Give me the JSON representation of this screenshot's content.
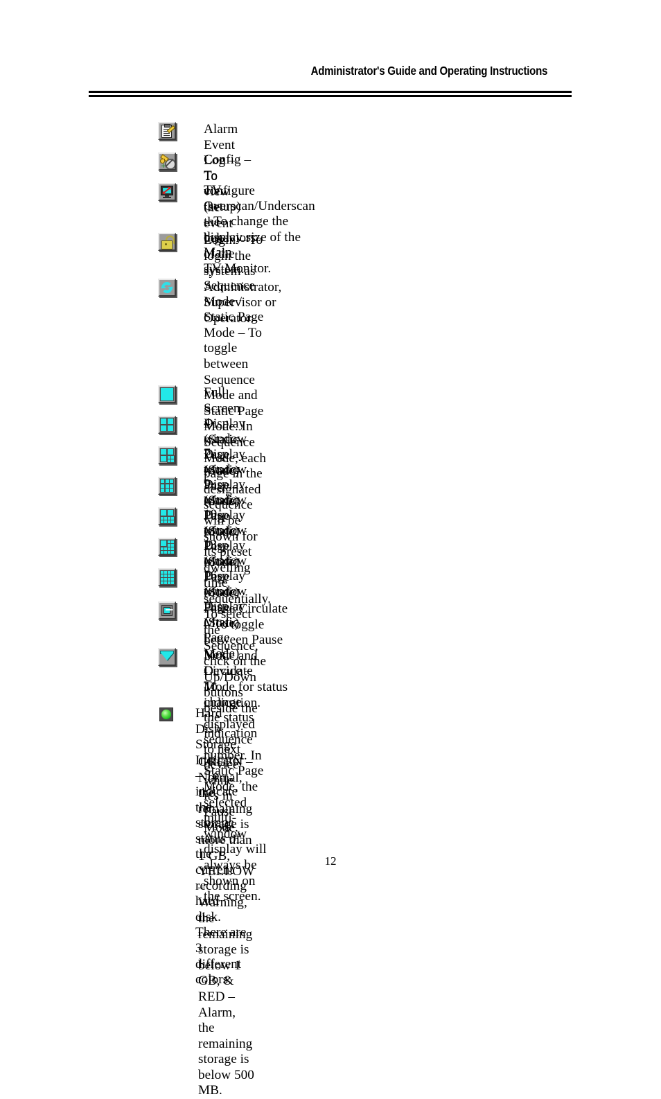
{
  "header": {
    "title": "Administrator's Guide and Operating Instructions"
  },
  "footer": {
    "page_number": "12"
  },
  "colors": {
    "icon_cyan": "#22e8e8",
    "icon_frame_gray": "#9c9c9c",
    "led_green": "#3ed42a",
    "arrow_red": "#d81f1f",
    "lock_yellow": "#ddd04a"
  },
  "entries": [
    {
      "icon": "alarm-event-log-icon",
      "text": "Alarm Event Log – To view the event log."
    },
    {
      "icon": "config-icon",
      "text": "Config – To configure (setup) the behaviors of the system."
    },
    {
      "icon": "tv-overscan-underscan-icon",
      "text": "TV Overscan/Underscan – To change the display size of the Main\nTV Monitor."
    },
    {
      "icon": "login-icon",
      "text": "Login – To login the system as Administrator, Supervisor or\nOperator."
    },
    {
      "icon": "sequence-mode-icon",
      "text": "Sequence Mode / Static Page Mode – To toggle between Sequence\nMode and Static Page Mode.    In Sequence Mode, each page in the\ndesignated sequence will be shown for its preset dwelling time\nsequentially.    To select the Sequence, click on the Up/Down buttons\nbeside the displayed sequence number.    In Static Page Mode, the\nselected multi-window display will always be shown on the screen."
    },
    {
      "icon": "full-screen-display-icon",
      "text": "Full Screen Display (Static Page Mode)"
    },
    {
      "icon": "four-window-display-icon",
      "text": "4-window Display (Static Page Mode)"
    },
    {
      "icon": "seven-window-display-icon",
      "text": "7-window Display (Static Page Mode)"
    },
    {
      "icon": "nine-window-display-icon",
      "text": "9-window Display (Static Page Mode)"
    },
    {
      "icon": "ten-window-display-icon",
      "text": "10-window Display (Static Page Mode)"
    },
    {
      "icon": "thirteen-window-display-icon",
      "text": "13-window Display (Static Page Mode)"
    },
    {
      "icon": "sixteen-window-display-icon",
      "text": "16-window Display (Static Page Mode)"
    },
    {
      "icon": "pause-circulate-icon",
      "text": "Pause/Circulate – To toggle between Pause Mode and Circulate\nMode for status indication."
    },
    {
      "icon": "next-device-icon",
      "text": "Next Device – To change the status indication to next device while\nit's in Pause Mode."
    }
  ],
  "hdd_section": {
    "icon": "hard-disk-storage-indicator-icon",
    "intro": "Hard Disk Storage Indicator – To indicate the storage status of the\n current recording hard disk.    There are 3 different colors:",
    "colors_text": "GREEN – Normal, the remaining storage is more than 1 GB,\nYELLOW – Warning, the remaining storage is below 1 GB, &\nRED – Alarm, the remaining storage is below 500 MB."
  }
}
